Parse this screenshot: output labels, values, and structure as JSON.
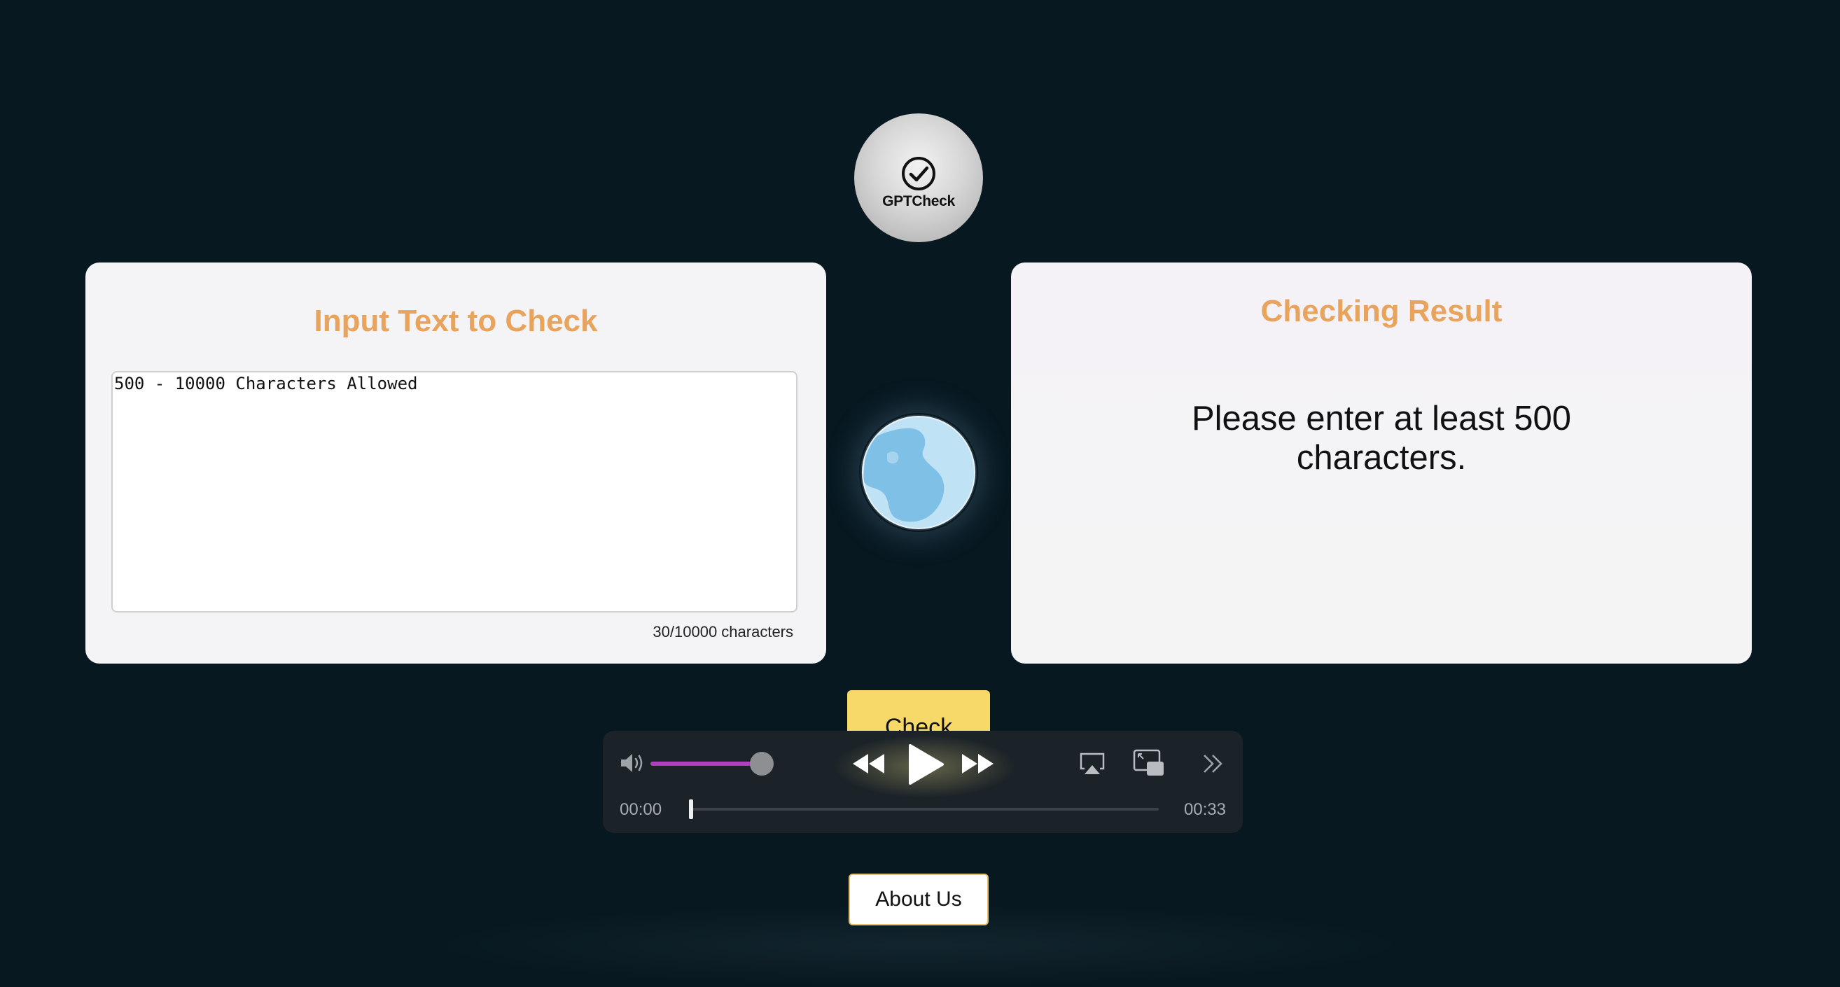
{
  "logo": {
    "text": "GPTCheck"
  },
  "input_panel": {
    "title": "Input Text to Check",
    "textarea_placeholder": "500 - 10000 Characters Allowed",
    "textarea_value": "",
    "char_count": "30/10000 characters"
  },
  "result_panel": {
    "title": "Checking Result",
    "message": "Please enter at least 500 characters."
  },
  "actions": {
    "check_label": "Check",
    "about_label": "About Us"
  },
  "player": {
    "current_time": "00:00",
    "duration": "00:33",
    "volume_fraction": 0.85,
    "progress_fraction": 0.0,
    "icons": [
      "volume-icon",
      "rewind-icon",
      "play-icon",
      "fast-forward-icon",
      "airplay-icon",
      "picture-in-picture-icon",
      "more-icon"
    ]
  },
  "colors": {
    "background": "#071820",
    "title_accent": "#e8a35c",
    "check_button": "#f7d96a",
    "volume_fill": "#b13fbf"
  }
}
